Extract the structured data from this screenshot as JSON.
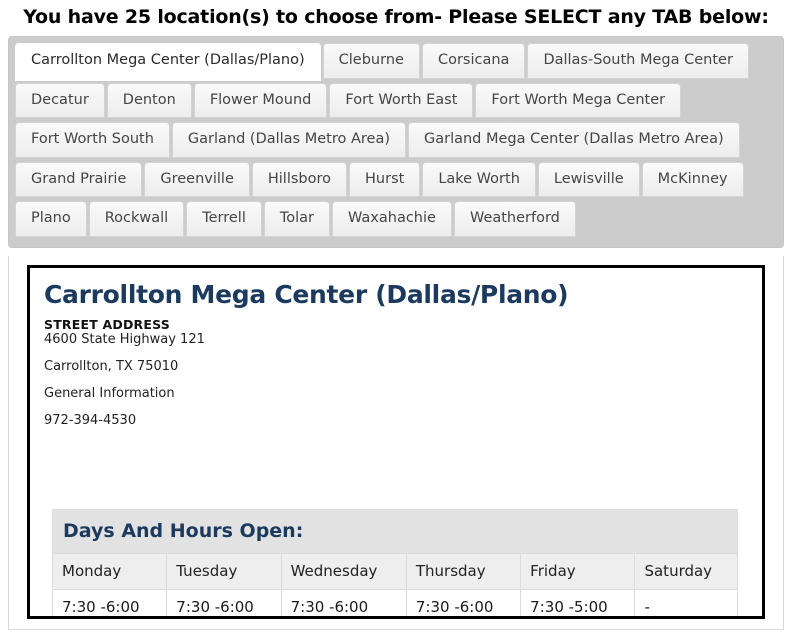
{
  "page": {
    "heading": "You have 25 location(s) to choose from- Please SELECT any TAB below:"
  },
  "tabs": {
    "active_index": 0,
    "items": [
      {
        "label": "Carrollton Mega Center (Dallas/Plano)",
        "active": true,
        "row": 1
      },
      {
        "label": "Cleburne",
        "active": false,
        "row": 1
      },
      {
        "label": "Corsicana",
        "active": false,
        "row": 1
      },
      {
        "label": "Dallas-South Mega Center",
        "active": false,
        "row": 1
      },
      {
        "label": "Decatur",
        "active": false,
        "row": 2
      },
      {
        "label": "Denton",
        "active": false,
        "row": 2
      },
      {
        "label": "Flower Mound",
        "active": false,
        "row": 2
      },
      {
        "label": "Fort Worth East",
        "active": false,
        "row": 2
      },
      {
        "label": "Fort Worth Mega Center",
        "active": false,
        "row": 2
      },
      {
        "label": "Fort Worth South",
        "active": false,
        "row": 3
      },
      {
        "label": "Garland (Dallas Metro Area)",
        "active": false,
        "row": 3
      },
      {
        "label": "Garland Mega Center (Dallas Metro Area)",
        "active": false,
        "row": 3
      },
      {
        "label": "Grand Prairie",
        "active": false,
        "row": 4
      },
      {
        "label": "Greenville",
        "active": false,
        "row": 4
      },
      {
        "label": "Hillsboro",
        "active": false,
        "row": 4
      },
      {
        "label": "Hurst",
        "active": false,
        "row": 4
      },
      {
        "label": "Lake Worth",
        "active": false,
        "row": 4
      },
      {
        "label": "Lewisville",
        "active": false,
        "row": 4
      },
      {
        "label": "McKinney",
        "active": false,
        "row": 4
      },
      {
        "label": "Plano",
        "active": false,
        "row": 5
      },
      {
        "label": "Rockwall",
        "active": false,
        "row": 5
      },
      {
        "label": "Terrell",
        "active": false,
        "row": 5
      },
      {
        "label": "Tolar",
        "active": false,
        "row": 5
      },
      {
        "label": "Waxahachie",
        "active": false,
        "row": 5
      },
      {
        "label": "Weatherford",
        "active": false,
        "row": 5
      }
    ]
  },
  "location": {
    "title": "Carrollton Mega Center (Dallas/Plano)",
    "street_address_label": "STREET ADDRESS",
    "address_line1": "4600 State Highway 121",
    "address_line2": "Carrollton, TX 75010",
    "contact_label": "General Information",
    "phone": "972-394-4530"
  },
  "hours": {
    "title": "Days And Hours Open:",
    "columns": [
      "Monday",
      "Tuesday",
      "Wednesday",
      "Thursday",
      "Friday",
      "Saturday"
    ],
    "values": [
      "7:30 -6:00",
      "7:30 -6:00",
      "7:30 -6:00",
      "7:30 -6:00",
      "7:30 -5:00",
      "-"
    ]
  },
  "colors": {
    "heading_text": "#000000",
    "title_navy": "#1b3a5e",
    "tab_strip_bg": "#cccccc",
    "tab_inactive_bg": "#ededed",
    "tab_active_bg": "#ffffff",
    "hours_header_bg": "#e2e2e2"
  }
}
